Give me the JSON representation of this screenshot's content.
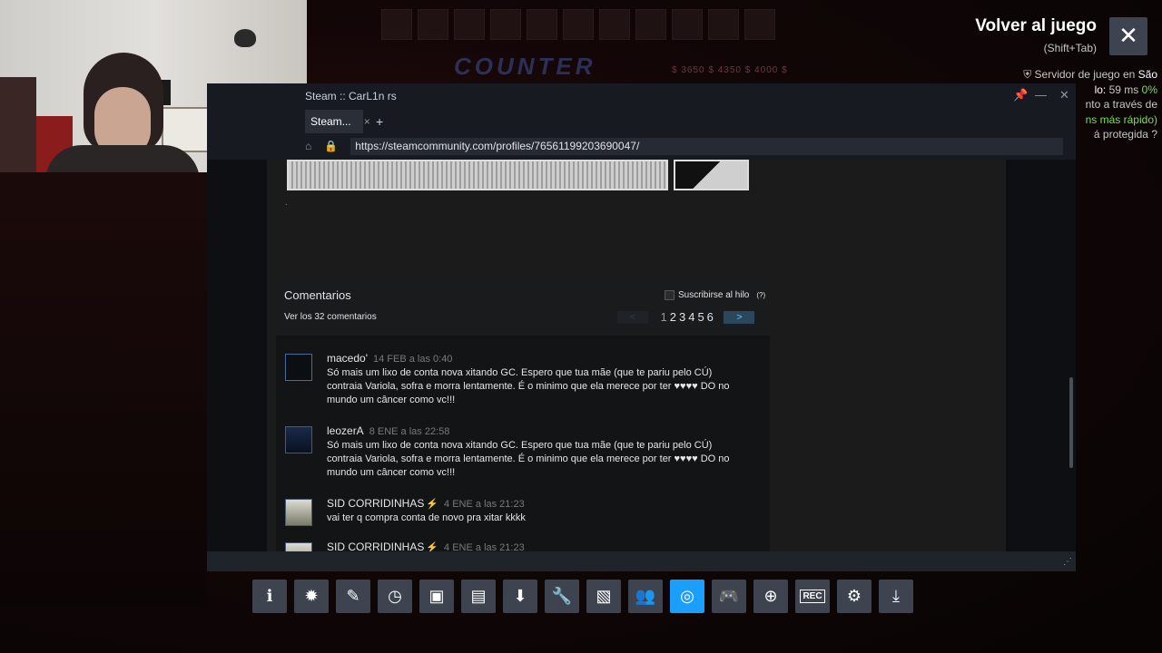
{
  "overlay": {
    "back_to_game": "Volver al juego",
    "shortcut": "(Shift+Tab)",
    "close_label": "✕",
    "server": {
      "line1_prefix": "Servidor de juego en",
      "line1_city": "São",
      "line2_label": "lo:",
      "line2_ping": "59 ms",
      "line2_loss": "0%",
      "line3": "nto a través de",
      "line4": "ns más rápido)",
      "line5": "á protegida"
    }
  },
  "browser": {
    "window_title": "Steam :: CarL1n rs",
    "tab_label": "Steam...",
    "tab_close": "×",
    "new_tab": "+",
    "url": "https://steamcommunity.com/profiles/76561199203690047/"
  },
  "comments": {
    "title": "Comentarios",
    "view_all": "Ver los 32 comentarios",
    "subscribe_label": "Suscribirse al hilo",
    "subscribe_help": "(?)",
    "pager": {
      "prev": "<",
      "next": ">",
      "pages": [
        "1",
        "2",
        "3",
        "4",
        "5",
        "6"
      ],
      "current": "1"
    },
    "items": [
      {
        "author": "macedo'",
        "date": "14 FEB a las 0:40",
        "text": "Só mais um lixo de conta nova xitando GC. Espero que tua mãe (que te pariu pelo CÚ) contraia Variola, sofra e morra lentamente. É o minimo que ela merece por ter ♥♥♥♥ DO no mundo um câncer como vc!!!"
      },
      {
        "author": "leozerA",
        "date": "8 ENE a las 22:58",
        "text": "Só mais um lixo de conta nova xitando GC. Espero que tua mãe (que te pariu pelo CÚ) contraia Variola, sofra e morra lentamente. É o minimo que ela merece por ter ♥♥♥♥ DO no mundo um câncer como vc!!!"
      },
      {
        "author": "SID CORRIDINHAS",
        "date": "4 ENE a las 21:23",
        "text": "vai ter q compra conta de novo pra xitar kkkk"
      },
      {
        "author": "SID CORRIDINHAS",
        "date": "4 ENE a las 21:23",
        "text": ""
      }
    ]
  },
  "toolbar": {
    "buttons": [
      {
        "name": "info-icon",
        "glyph": "ℹ"
      },
      {
        "name": "achievements-icon",
        "glyph": "✹"
      },
      {
        "name": "notes-icon",
        "glyph": "✎"
      },
      {
        "name": "timer-icon",
        "glyph": "◷"
      },
      {
        "name": "guides-icon",
        "glyph": "▣"
      },
      {
        "name": "discussions-icon",
        "glyph": "▤"
      },
      {
        "name": "downloads-icon",
        "glyph": "⬇"
      },
      {
        "name": "settings-wrench-icon",
        "glyph": "🔧"
      },
      {
        "name": "screenshots-icon",
        "glyph": "▧"
      },
      {
        "name": "friends-icon",
        "glyph": "👥"
      },
      {
        "name": "browser-icon",
        "glyph": "◎"
      },
      {
        "name": "controller-icon",
        "glyph": "🎮"
      },
      {
        "name": "web-icon",
        "glyph": "⊕"
      },
      {
        "name": "recording-icon",
        "glyph": "REC"
      },
      {
        "name": "gear-icon",
        "glyph": "⚙"
      },
      {
        "name": "minimize-icon",
        "glyph": "⤓"
      }
    ],
    "active_index": 10
  },
  "background": {
    "game_title": "COUNTER",
    "prices": "$ 3650 $ 4350 $ 4000 $"
  }
}
